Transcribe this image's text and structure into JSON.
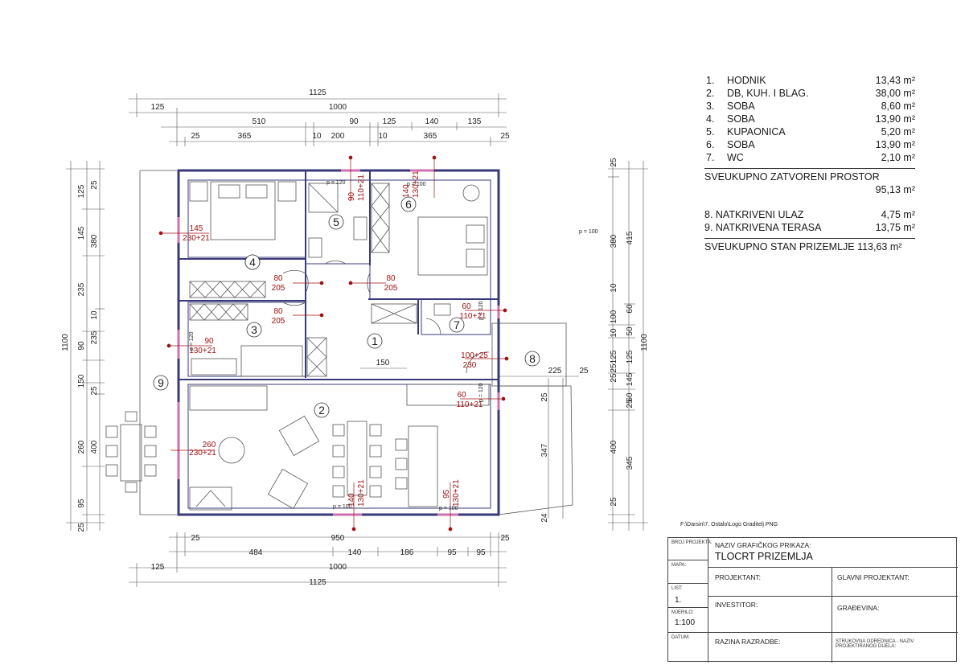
{
  "legend": {
    "rooms": [
      {
        "no": "1.",
        "name": "HODNIK",
        "area": "13,43 m²"
      },
      {
        "no": "2.",
        "name": "DB, KUH. I BLAG.",
        "area": "38,00 m²"
      },
      {
        "no": "3.",
        "name": "SOBA",
        "area": "8,60 m²"
      },
      {
        "no": "4.",
        "name": "SOBA",
        "area": "13,90 m²"
      },
      {
        "no": "5.",
        "name": "KUPAONICA",
        "area": "5,20 m²"
      },
      {
        "no": "6.",
        "name": "SOBA",
        "area": "13,90 m²"
      },
      {
        "no": "7.",
        "name": "WC",
        "area": "2,10 m²"
      }
    ],
    "total_closed_label": "SVEUKUPNO ZATVORENI PROSTOR",
    "total_closed_value": "95,13 m²",
    "extras": [
      {
        "name": "8. NATKRIVENI ULAZ",
        "area": "4,75 m²"
      },
      {
        "name": "9. NATKRIVENA TERASA",
        "area": "13,75 m²"
      }
    ],
    "total_label": "SVEUKUPNO STAN PRIZEMLJE 113,63 m²"
  },
  "plan": {
    "room_numbers": [
      "1",
      "2",
      "3",
      "4",
      "5",
      "6",
      "7",
      "8",
      "9"
    ],
    "dims_top": {
      "row1": [
        "1125"
      ],
      "row2": [
        "125",
        "1000"
      ],
      "row3": [
        "510",
        "90",
        "125",
        "140",
        "135"
      ],
      "row4": [
        "25",
        "365",
        "10",
        "200",
        "10",
        "365",
        "25"
      ]
    },
    "dims_bottom": {
      "row1": [
        "25",
        "950",
        "25"
      ],
      "row2": [
        "484",
        "140",
        "186",
        "95",
        "95"
      ],
      "row3": [
        "125",
        "1000"
      ],
      "row4": [
        "1125"
      ]
    },
    "dims_left": {
      "outer": "1100",
      "mid": [
        "125",
        "145",
        "235",
        "90",
        "150",
        "260",
        "95",
        "25"
      ],
      "inner": [
        "25",
        "380",
        "10",
        "235",
        "25",
        "400"
      ]
    },
    "dims_right": {
      "outer": "1100",
      "a": [
        "25",
        "415",
        "10",
        "10",
        "125",
        "25",
        "125",
        "60",
        "345",
        "25"
      ],
      "b": [
        "380",
        "100",
        "50",
        "145",
        "25",
        "400"
      ],
      "c": [
        "60",
        "25"
      ],
      "terrace": [
        "225",
        "25",
        "347",
        "24"
      ]
    },
    "openings": [
      {
        "w": "145",
        "h": "230+21"
      },
      {
        "w": "90",
        "h": "110+21"
      },
      {
        "w": "140",
        "h": "130+21"
      },
      {
        "w": "80",
        "h": "205"
      },
      {
        "w": "80",
        "h": "205"
      },
      {
        "w": "80",
        "h": "205"
      },
      {
        "w": "60",
        "h": "110+21"
      },
      {
        "w": "90",
        "h": "130+21"
      },
      {
        "w": "100+25",
        "h": "230"
      },
      {
        "w": "60",
        "h": "110+21"
      },
      {
        "w": "260",
        "h": "230+21"
      },
      {
        "w": "140",
        "h": "130+21"
      },
      {
        "w": "95",
        "h": "130+21"
      }
    ],
    "parapet_labels": [
      "p = 120",
      "p = 100",
      "p = 100",
      "p = 100",
      "p = 100",
      "p = 120",
      "p = 120"
    ],
    "corridor_dim": "150",
    "file_path": "F:\\Darsin\\7. Ostalo\\Logo Graditelj PNG"
  },
  "title_block": {
    "broj_label": "BROJ PROJEKTA:",
    "naziv_label": "NAZIV GRAFIČKOG PRIKAZA:",
    "naziv_value": "TLOCRT PRIZEMLJA",
    "mapa_label": "MAPA:",
    "list_label": "LIST:",
    "list_value": "1.",
    "mjerilo_label": "MJERILO:",
    "mjerilo_value": "1:100",
    "datum_label": "DATUM:",
    "projektant_label": "PROJEKTANT:",
    "glavni_label": "GLAVNI PROJEKTANT:",
    "investitor_label": "INVESTITOR:",
    "gradevina_label": "GRAĐEVINA:",
    "razina_label": "RAZINA RAZRADBE:",
    "strukovna_label": "STRUKOVNA ODREDNICA - NAZIV PROJEKTIRANOG DIJELA:"
  },
  "colors": {
    "wall": "#3a3a7a",
    "red": "#a01010",
    "line": "#333333"
  }
}
